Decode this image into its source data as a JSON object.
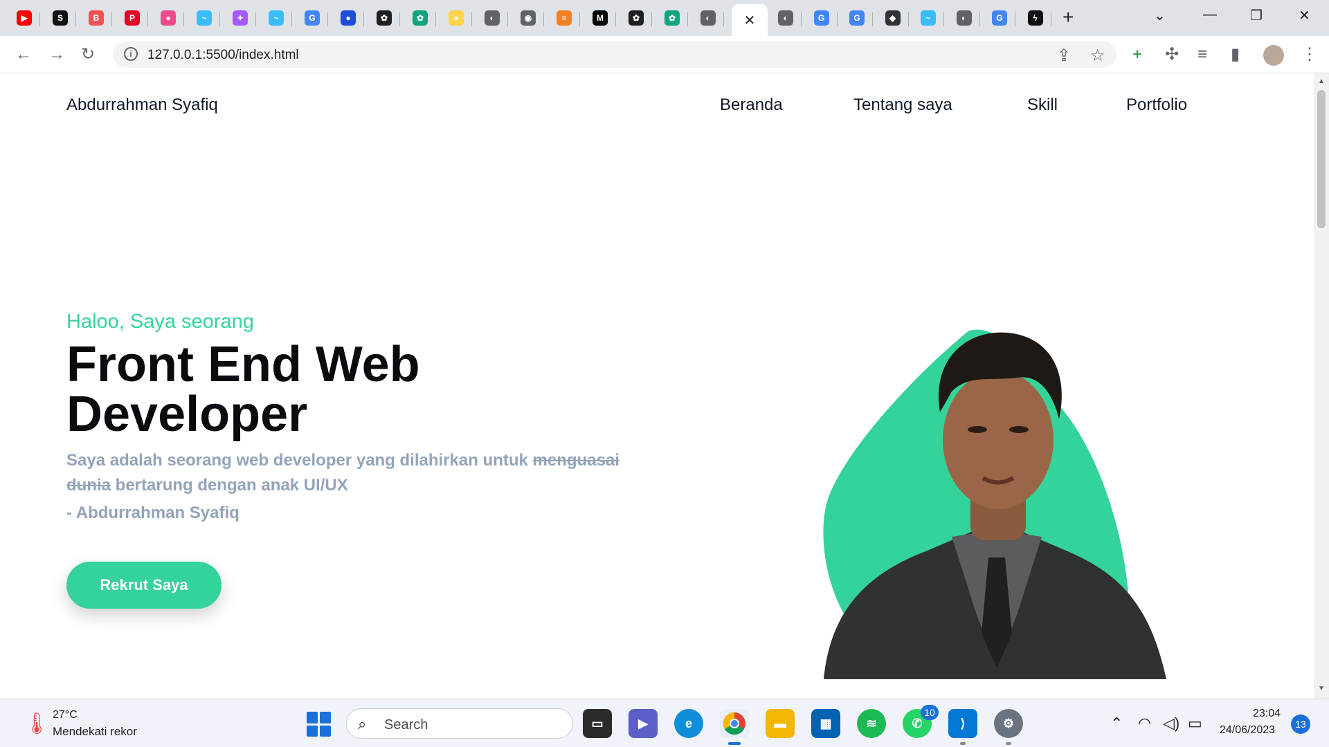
{
  "browser": {
    "tabs": [
      {
        "icon": "youtube-icon",
        "color": "#ff0000",
        "glyph": "▶"
      },
      {
        "icon": "app-icon",
        "color": "#111111",
        "glyph": "S"
      },
      {
        "icon": "blogger-icon",
        "color": "#ef5350",
        "glyph": "B"
      },
      {
        "icon": "pinterest-icon",
        "color": "#e60023",
        "glyph": "P"
      },
      {
        "icon": "dribbble-icon",
        "color": "#ea4c89",
        "glyph": "●"
      },
      {
        "icon": "tailwind-icon",
        "color": "#38bdf8",
        "glyph": "~"
      },
      {
        "icon": "figma-icon",
        "color": "#a259ff",
        "glyph": "✦"
      },
      {
        "icon": "tailwind-icon",
        "color": "#38bdf8",
        "glyph": "~"
      },
      {
        "icon": "google-icon",
        "color": "#4285f4",
        "glyph": "G"
      },
      {
        "icon": "app-icon",
        "color": "#1d4ed8",
        "glyph": "●"
      },
      {
        "icon": "chatgpt-icon",
        "color": "#1f1f1f",
        "glyph": "✿"
      },
      {
        "icon": "chatgpt-icon",
        "color": "#10a37f",
        "glyph": "✿"
      },
      {
        "icon": "bulb-icon",
        "color": "#fcd34d",
        "glyph": "●"
      },
      {
        "icon": "globe-icon",
        "color": "#5f6368",
        "glyph": "◐"
      },
      {
        "icon": "chrome-icon",
        "color": "#5f6368",
        "glyph": "◉"
      },
      {
        "icon": "stackoverflow-icon",
        "color": "#f48024",
        "glyph": "≡"
      },
      {
        "icon": "medium-icon",
        "color": "#000000",
        "glyph": "M"
      },
      {
        "icon": "chatgpt-icon",
        "color": "#1f1f1f",
        "glyph": "✿"
      },
      {
        "icon": "chatgpt-icon",
        "color": "#10a37f",
        "glyph": "✿"
      },
      {
        "icon": "globe-icon",
        "color": "#5f6368",
        "glyph": "◐"
      },
      {
        "icon": "globe-icon",
        "color": "#5f6368",
        "glyph": "◐"
      },
      {
        "icon": "google-icon",
        "color": "#4285f4",
        "glyph": "G"
      },
      {
        "icon": "google-icon",
        "color": "#4285f4",
        "glyph": "G"
      },
      {
        "icon": "app-icon",
        "color": "#333333",
        "glyph": "◆"
      },
      {
        "icon": "tailwind-icon",
        "color": "#38bdf8",
        "glyph": "~"
      },
      {
        "icon": "globe-icon",
        "color": "#5f6368",
        "glyph": "◐"
      },
      {
        "icon": "google-icon",
        "color": "#4285f4",
        "glyph": "G"
      },
      {
        "icon": "bolt-icon",
        "color": "#111111",
        "glyph": "ϟ"
      }
    ],
    "active_close": "✕",
    "url": "127.0.0.1:5500/index.html"
  },
  "page": {
    "brand": "Abdurrahman Syafiq",
    "nav": [
      "Beranda",
      "Tentang saya",
      "Skill",
      "Portfolio"
    ],
    "greeting": "Haloo, Saya seorang",
    "headline_line1": "Front End Web",
    "headline_line2": "Developer",
    "desc_before": "Saya adalah seorang web developer yang dilahirkan untuk ",
    "desc_strike": "menguasai dunia",
    "desc_after": " bertarung dengan anak UI/UX",
    "author": "- Abdurrahman Syafiq",
    "cta_label": "Rekrut Saya",
    "accent_color": "#34d399"
  },
  "taskbar": {
    "weather_temp": "27°C",
    "weather_desc": "Mendekati rekor",
    "search_label": "Search",
    "whatsapp_badge": "10",
    "time": "23:04",
    "date": "24/06/2023",
    "notifications": "13"
  }
}
